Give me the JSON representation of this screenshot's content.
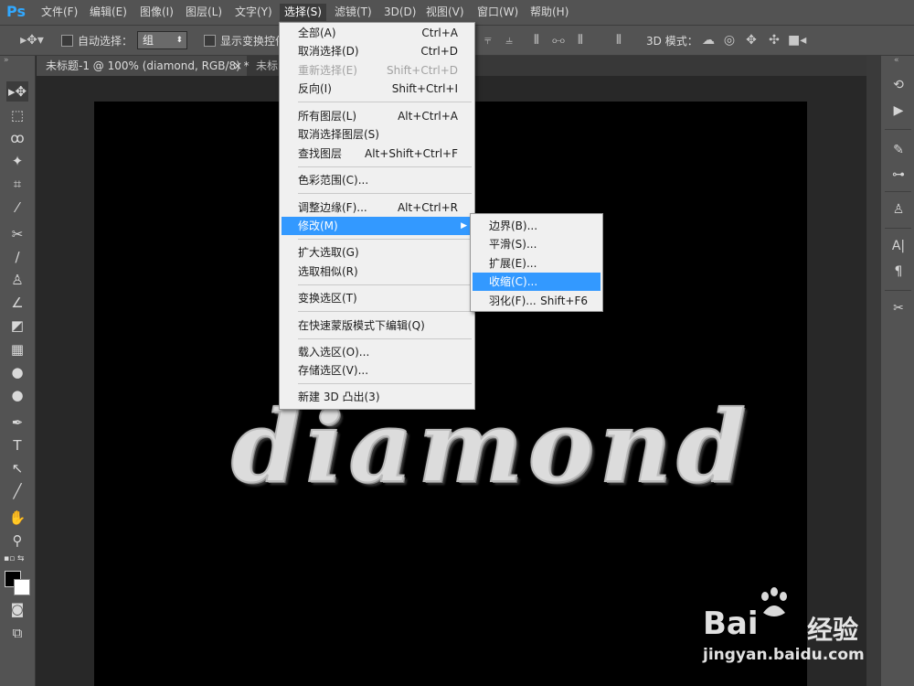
{
  "app": {
    "logo": "Ps"
  },
  "menubar": {
    "items": [
      "文件(F)",
      "编辑(E)",
      "图像(I)",
      "图层(L)",
      "文字(Y)",
      "选择(S)",
      "滤镜(T)",
      "3D(D)",
      "视图(V)",
      "窗口(W)",
      "帮助(H)"
    ],
    "active_index": 5
  },
  "options": {
    "auto_select_label": "自动选择：",
    "auto_select_value": "组",
    "show_transform_label": "显示变换控件",
    "mode_3d_label": "3D 模式："
  },
  "tabs": [
    {
      "label": "未标题-1 @ 100% (diamond, RGB/8) *",
      "close": "×"
    },
    {
      "label": "未标"
    }
  ],
  "canvas": {
    "text": "diamond"
  },
  "select_menu": {
    "items": [
      {
        "label": "全部(A)",
        "shortcut": "Ctrl+A",
        "enabled": true
      },
      {
        "label": "取消选择(D)",
        "shortcut": "Ctrl+D",
        "enabled": true
      },
      {
        "label": "重新选择(E)",
        "shortcut": "Shift+Ctrl+D",
        "enabled": false
      },
      {
        "label": "反向(I)",
        "shortcut": "Shift+Ctrl+I",
        "enabled": true
      },
      {
        "label": "所有图层(L)",
        "shortcut": "Alt+Ctrl+A",
        "enabled": true
      },
      {
        "label": "取消选择图层(S)",
        "shortcut": "",
        "enabled": true
      },
      {
        "label": "查找图层",
        "shortcut": "Alt+Shift+Ctrl+F",
        "enabled": true
      },
      {
        "label": "色彩范围(C)...",
        "shortcut": "",
        "enabled": true
      },
      {
        "label": "调整边缘(F)...",
        "shortcut": "Alt+Ctrl+R",
        "enabled": true
      },
      {
        "label": "修改(M)",
        "shortcut": "",
        "enabled": true,
        "highlighted": true,
        "submenu": true
      },
      {
        "label": "扩大选取(G)",
        "shortcut": "",
        "enabled": true
      },
      {
        "label": "选取相似(R)",
        "shortcut": "",
        "enabled": true
      },
      {
        "label": "变换选区(T)",
        "shortcut": "",
        "enabled": true
      },
      {
        "label": "在快速蒙版模式下编辑(Q)",
        "shortcut": "",
        "enabled": true
      },
      {
        "label": "载入选区(O)...",
        "shortcut": "",
        "enabled": true
      },
      {
        "label": "存储选区(V)...",
        "shortcut": "",
        "enabled": true
      },
      {
        "label": "新建 3D 凸出(3)",
        "shortcut": "",
        "enabled": true
      }
    ]
  },
  "modify_submenu": {
    "items": [
      {
        "label": "边界(B)...",
        "shortcut": ""
      },
      {
        "label": "平滑(S)...",
        "shortcut": ""
      },
      {
        "label": "扩展(E)...",
        "shortcut": ""
      },
      {
        "label": "收缩(C)...",
        "shortcut": "",
        "highlighted": true
      },
      {
        "label": "羽化(F)...",
        "shortcut": "Shift+F6"
      }
    ]
  },
  "watermark": {
    "brand": "Bai",
    "brand2": "经验",
    "url": "jingyan.baidu.com"
  },
  "colors": {
    "menu_highlight": "#3399ff",
    "chrome": "#535353",
    "logo": "#31a8ff"
  }
}
